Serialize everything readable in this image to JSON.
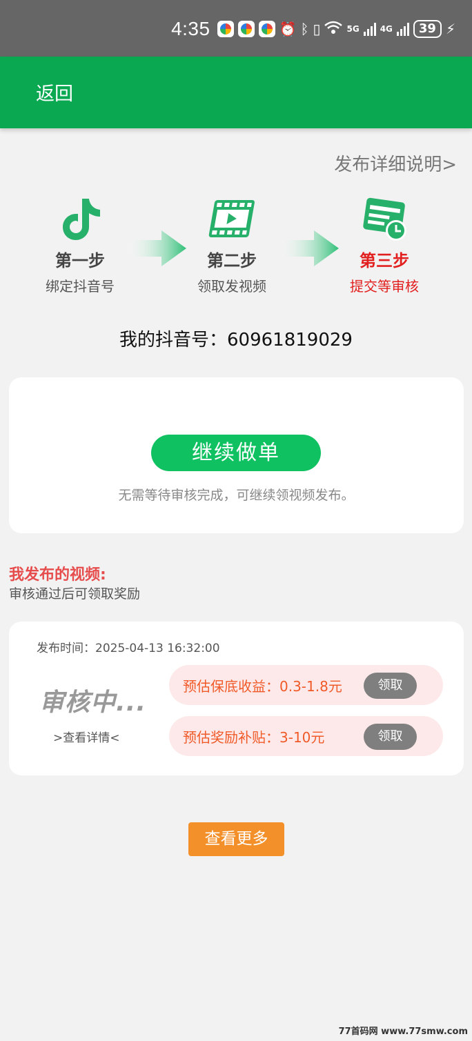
{
  "status_bar": {
    "time": "4:35",
    "network_5g": "5G",
    "network_4g": "4G",
    "battery": "39"
  },
  "header": {
    "back_label": "返回"
  },
  "detail_link": "发布详细说明>",
  "steps": [
    {
      "title": "第一步",
      "subtitle": "绑定抖音号",
      "icon": "tiktok-icon"
    },
    {
      "title": "第二步",
      "subtitle": "领取发视频",
      "icon": "video-icon"
    },
    {
      "title": "第三步",
      "subtitle": "提交等审核",
      "icon": "review-clock-icon"
    }
  ],
  "account": {
    "label": "我的抖音号：60961819029"
  },
  "continue_card": {
    "button_label": "继续做单",
    "note": "无需等待审核完成，可继续领视频发布。"
  },
  "my_videos": {
    "title": "我发布的视频:",
    "subtitle": "审核通过后可领取奖励"
  },
  "video_item": {
    "publish_time": "发布时间：2025-04-13 16:32:00",
    "status": "审核中...",
    "view_detail": ">查看详情<",
    "rewards": [
      {
        "text": "预估保底收益：0.3-1.8元",
        "button": "领取"
      },
      {
        "text": "预估奖励补贴：3-10元",
        "button": "领取"
      }
    ]
  },
  "more_button": "查看更多",
  "watermark": "77首码网 www.77smw.com",
  "colors": {
    "header_green": "#0aa951",
    "button_green": "#0fc160",
    "active_step_red": "#e21f1f",
    "section_title_red": "#e74c4c",
    "reward_orange": "#f05a28",
    "more_button_orange": "#f4902a"
  }
}
